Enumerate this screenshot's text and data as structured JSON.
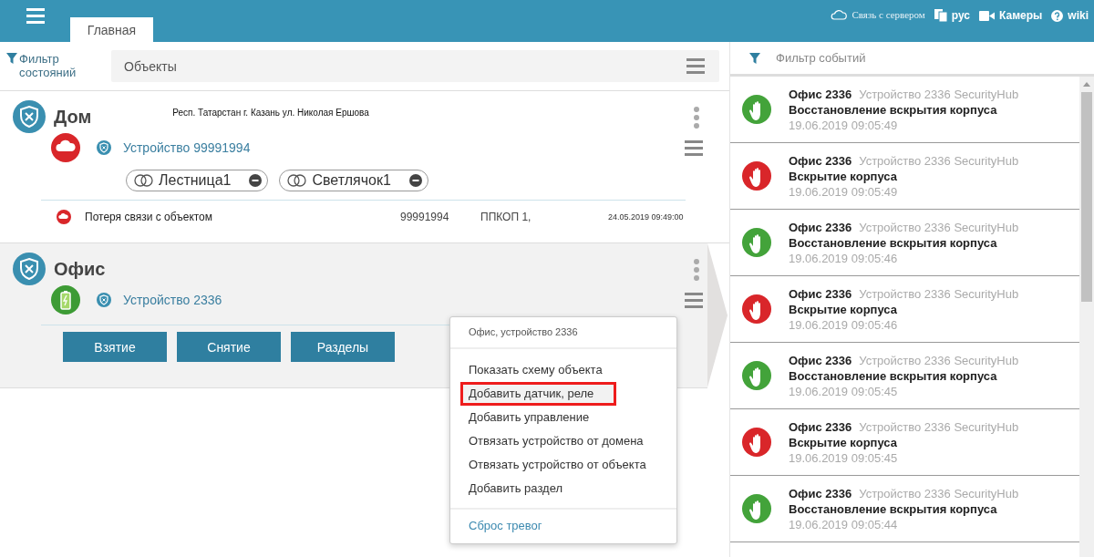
{
  "header": {
    "tabs": [
      {
        "label": "Главная",
        "selected": true
      }
    ],
    "server_status": "Связь с сервером",
    "language": "рус",
    "cameras": "Камеры",
    "wiki": "wiki"
  },
  "filter": {
    "label": "Фильтр состояний",
    "search_placeholder": "Объекты"
  },
  "objects": [
    {
      "name": "Дом",
      "address": "Респ. Татарстан г. Казань ул. Николая Ершова",
      "selected": false,
      "device": {
        "name": "Устройство 99991994",
        "kind": "offline"
      },
      "chips": [
        {
          "label": "Лестница1"
        },
        {
          "label": "Светлячок1"
        }
      ],
      "events": [
        {
          "kind": "offline",
          "text": "Потеря связи с объектом",
          "device": "99991994",
          "panel": "ППКОП 1,",
          "time": "24.05.2019 09:49:00"
        }
      ]
    },
    {
      "name": "Офис",
      "selected": true,
      "device": {
        "name": "Устройство 2336",
        "kind": "battery"
      },
      "buttons": [
        "Взятие",
        "Снятие",
        "Разделы"
      ]
    }
  ],
  "context_menu": {
    "title": "Офис, устройство 2336",
    "items": [
      {
        "label": "Показать схему объекта",
        "selected": false
      },
      {
        "label": "Добавить датчик, реле",
        "selected": true
      },
      {
        "label": "Добавить управление",
        "selected": false
      },
      {
        "label": "Отвязать устройство от домена",
        "selected": false
      },
      {
        "label": "Отвязать устройство от объекта",
        "selected": false
      },
      {
        "label": "Добавить раздел",
        "selected": false
      }
    ],
    "footer": "Сброс тревог"
  },
  "events_panel": {
    "filter_label": "Фильтр событий",
    "events": [
      {
        "kind": "restore",
        "object": "Офис 2336",
        "device": "Устройство 2336 SecurityHub",
        "text": "Восстановление вскрытия корпуса",
        "time": "19.06.2019 09:05:49"
      },
      {
        "kind": "alarm",
        "object": "Офис 2336",
        "device": "Устройство 2336 SecurityHub",
        "text": "Вскрытие корпуса",
        "time": "19.06.2019 09:05:49"
      },
      {
        "kind": "restore",
        "object": "Офис 2336",
        "device": "Устройство 2336 SecurityHub",
        "text": "Восстановление вскрытия корпуса",
        "time": "19.06.2019 09:05:46"
      },
      {
        "kind": "alarm",
        "object": "Офис 2336",
        "device": "Устройство 2336 SecurityHub",
        "text": "Вскрытие корпуса",
        "time": "19.06.2019 09:05:46"
      },
      {
        "kind": "restore",
        "object": "Офис 2336",
        "device": "Устройство 2336 SecurityHub",
        "text": "Восстановление вскрытия корпуса",
        "time": "19.06.2019 09:05:45"
      },
      {
        "kind": "alarm",
        "object": "Офис 2336",
        "device": "Устройство 2336 SecurityHub",
        "text": "Вскрытие корпуса",
        "time": "19.06.2019 09:05:45"
      },
      {
        "kind": "restore",
        "object": "Офис 2336",
        "device": "Устройство 2336 SecurityHub",
        "text": "Восстановление вскрытия корпуса",
        "time": "19.06.2019 09:05:44"
      }
    ]
  }
}
